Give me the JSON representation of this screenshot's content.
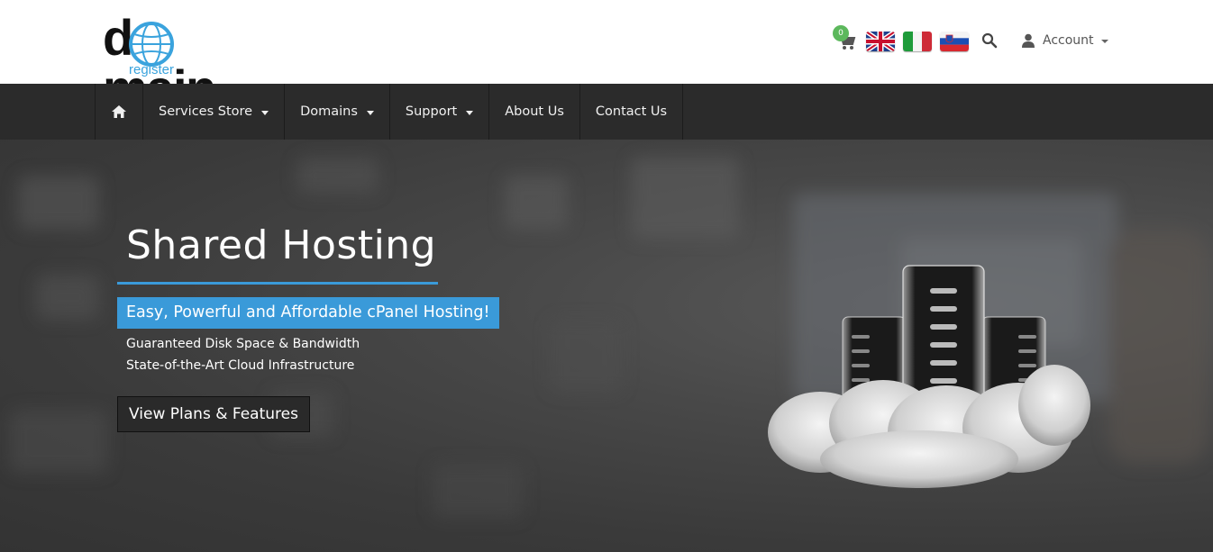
{
  "header": {
    "logo": {
      "text_start": "d",
      "text_end": "main",
      "subtitle": "register"
    },
    "cart": {
      "count": "0"
    },
    "languages": [
      "english-flag",
      "italian-flag",
      "slovenian-flag"
    ],
    "account": {
      "label": "Account"
    }
  },
  "nav": {
    "items": [
      {
        "label": "Services Store",
        "dropdown": true
      },
      {
        "label": "Domains",
        "dropdown": true
      },
      {
        "label": "Support",
        "dropdown": true
      },
      {
        "label": "About Us",
        "dropdown": false
      },
      {
        "label": "Contact Us",
        "dropdown": false
      }
    ]
  },
  "hero": {
    "title": "Shared Hosting",
    "tagline": "Easy, Powerful and Affordable cPanel Hosting!",
    "features": [
      "Guaranteed Disk Space & Bandwidth",
      "State-of-the-Art Cloud Infrastructure"
    ],
    "button_label": "View Plans & Features"
  },
  "colors": {
    "accent": "#3a9ad9",
    "nav_bg": "#2b2b2b",
    "badge": "#5cb85c",
    "logo_blue": "#3aa3dd"
  },
  "icons": [
    "globe-icon",
    "cart-icon",
    "search-icon",
    "user-icon",
    "home-icon",
    "server-cloud-illustration"
  ]
}
